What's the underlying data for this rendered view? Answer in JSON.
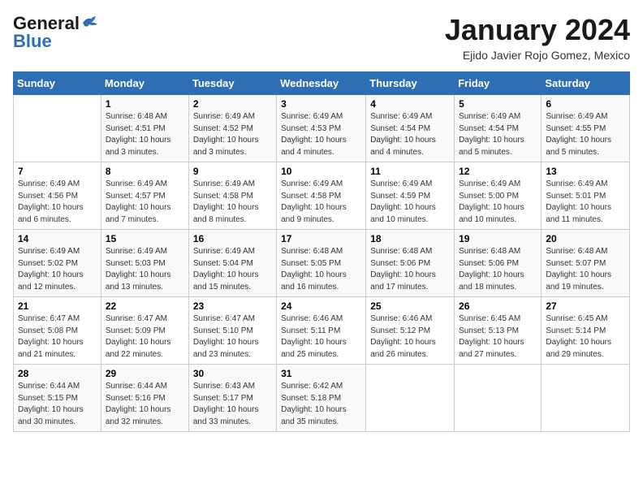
{
  "header": {
    "logo_line1": "General",
    "logo_line2": "Blue",
    "title": "January 2024",
    "location": "Ejido Javier Rojo Gomez, Mexico"
  },
  "columns": [
    "Sunday",
    "Monday",
    "Tuesday",
    "Wednesday",
    "Thursday",
    "Friday",
    "Saturday"
  ],
  "weeks": [
    [
      {
        "day": "",
        "info": ""
      },
      {
        "day": "1",
        "info": "Sunrise: 6:48 AM\nSunset: 4:51 PM\nDaylight: 10 hours\nand 3 minutes."
      },
      {
        "day": "2",
        "info": "Sunrise: 6:49 AM\nSunset: 4:52 PM\nDaylight: 10 hours\nand 3 minutes."
      },
      {
        "day": "3",
        "info": "Sunrise: 6:49 AM\nSunset: 4:53 PM\nDaylight: 10 hours\nand 4 minutes."
      },
      {
        "day": "4",
        "info": "Sunrise: 6:49 AM\nSunset: 4:54 PM\nDaylight: 10 hours\nand 4 minutes."
      },
      {
        "day": "5",
        "info": "Sunrise: 6:49 AM\nSunset: 4:54 PM\nDaylight: 10 hours\nand 5 minutes."
      },
      {
        "day": "6",
        "info": "Sunrise: 6:49 AM\nSunset: 4:55 PM\nDaylight: 10 hours\nand 5 minutes."
      }
    ],
    [
      {
        "day": "7",
        "info": "Sunrise: 6:49 AM\nSunset: 4:56 PM\nDaylight: 10 hours\nand 6 minutes."
      },
      {
        "day": "8",
        "info": "Sunrise: 6:49 AM\nSunset: 4:57 PM\nDaylight: 10 hours\nand 7 minutes."
      },
      {
        "day": "9",
        "info": "Sunrise: 6:49 AM\nSunset: 4:58 PM\nDaylight: 10 hours\nand 8 minutes."
      },
      {
        "day": "10",
        "info": "Sunrise: 6:49 AM\nSunset: 4:58 PM\nDaylight: 10 hours\nand 9 minutes."
      },
      {
        "day": "11",
        "info": "Sunrise: 6:49 AM\nSunset: 4:59 PM\nDaylight: 10 hours\nand 10 minutes."
      },
      {
        "day": "12",
        "info": "Sunrise: 6:49 AM\nSunset: 5:00 PM\nDaylight: 10 hours\nand 10 minutes."
      },
      {
        "day": "13",
        "info": "Sunrise: 6:49 AM\nSunset: 5:01 PM\nDaylight: 10 hours\nand 11 minutes."
      }
    ],
    [
      {
        "day": "14",
        "info": "Sunrise: 6:49 AM\nSunset: 5:02 PM\nDaylight: 10 hours\nand 12 minutes."
      },
      {
        "day": "15",
        "info": "Sunrise: 6:49 AM\nSunset: 5:03 PM\nDaylight: 10 hours\nand 13 minutes."
      },
      {
        "day": "16",
        "info": "Sunrise: 6:49 AM\nSunset: 5:04 PM\nDaylight: 10 hours\nand 15 minutes."
      },
      {
        "day": "17",
        "info": "Sunrise: 6:48 AM\nSunset: 5:05 PM\nDaylight: 10 hours\nand 16 minutes."
      },
      {
        "day": "18",
        "info": "Sunrise: 6:48 AM\nSunset: 5:06 PM\nDaylight: 10 hours\nand 17 minutes."
      },
      {
        "day": "19",
        "info": "Sunrise: 6:48 AM\nSunset: 5:06 PM\nDaylight: 10 hours\nand 18 minutes."
      },
      {
        "day": "20",
        "info": "Sunrise: 6:48 AM\nSunset: 5:07 PM\nDaylight: 10 hours\nand 19 minutes."
      }
    ],
    [
      {
        "day": "21",
        "info": "Sunrise: 6:47 AM\nSunset: 5:08 PM\nDaylight: 10 hours\nand 21 minutes."
      },
      {
        "day": "22",
        "info": "Sunrise: 6:47 AM\nSunset: 5:09 PM\nDaylight: 10 hours\nand 22 minutes."
      },
      {
        "day": "23",
        "info": "Sunrise: 6:47 AM\nSunset: 5:10 PM\nDaylight: 10 hours\nand 23 minutes."
      },
      {
        "day": "24",
        "info": "Sunrise: 6:46 AM\nSunset: 5:11 PM\nDaylight: 10 hours\nand 25 minutes."
      },
      {
        "day": "25",
        "info": "Sunrise: 6:46 AM\nSunset: 5:12 PM\nDaylight: 10 hours\nand 26 minutes."
      },
      {
        "day": "26",
        "info": "Sunrise: 6:45 AM\nSunset: 5:13 PM\nDaylight: 10 hours\nand 27 minutes."
      },
      {
        "day": "27",
        "info": "Sunrise: 6:45 AM\nSunset: 5:14 PM\nDaylight: 10 hours\nand 29 minutes."
      }
    ],
    [
      {
        "day": "28",
        "info": "Sunrise: 6:44 AM\nSunset: 5:15 PM\nDaylight: 10 hours\nand 30 minutes."
      },
      {
        "day": "29",
        "info": "Sunrise: 6:44 AM\nSunset: 5:16 PM\nDaylight: 10 hours\nand 32 minutes."
      },
      {
        "day": "30",
        "info": "Sunrise: 6:43 AM\nSunset: 5:17 PM\nDaylight: 10 hours\nand 33 minutes."
      },
      {
        "day": "31",
        "info": "Sunrise: 6:42 AM\nSunset: 5:18 PM\nDaylight: 10 hours\nand 35 minutes."
      },
      {
        "day": "",
        "info": ""
      },
      {
        "day": "",
        "info": ""
      },
      {
        "day": "",
        "info": ""
      }
    ]
  ]
}
